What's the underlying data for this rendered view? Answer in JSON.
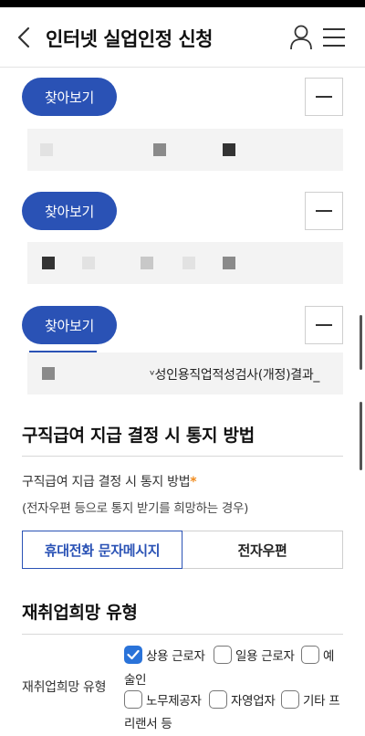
{
  "header": {
    "title": "인터넷 실업인정 신청",
    "icons": {
      "back": "chevron-left-icon",
      "user": "user-icon",
      "menu": "hamburger-menu-icon"
    }
  },
  "attachments": {
    "search_label": "찾아보기",
    "rows": [
      {
        "file_name": ""
      },
      {
        "file_name": ""
      },
      {
        "file_name": "ᵛ성인용직업적성검사(개정)결과_"
      }
    ]
  },
  "notify": {
    "section_title": "구직급여 지급 결정 시 통지 방법",
    "field_label": "구직급여 지급 결정 시 통지 방법",
    "required_mark": "*",
    "hint": "(전자우편 등으로 통지 받기를 희망하는 경우)",
    "options": [
      "휴대전화 문자메시지",
      "전자우편"
    ],
    "selected": "휴대전화 문자메시지"
  },
  "reemployment": {
    "section_title": "재취업희망 유형",
    "field_label": "재취업희망 유형",
    "options": [
      {
        "label": "상용 근로자",
        "checked": true
      },
      {
        "label": "일용 근로자",
        "checked": false
      },
      {
        "label": "예",
        "checked": false
      },
      {
        "label": "술인",
        "checked": false
      },
      {
        "label": "노무제공자",
        "checked": false
      },
      {
        "label": "자영업자",
        "checked": false
      },
      {
        "label": "기타 프",
        "checked": false
      },
      {
        "label": "리랜서 등",
        "checked": false
      }
    ]
  },
  "colors": {
    "primary": "#2a52b5",
    "checkbox": "#2a73d9",
    "required": "#f08a1c"
  }
}
